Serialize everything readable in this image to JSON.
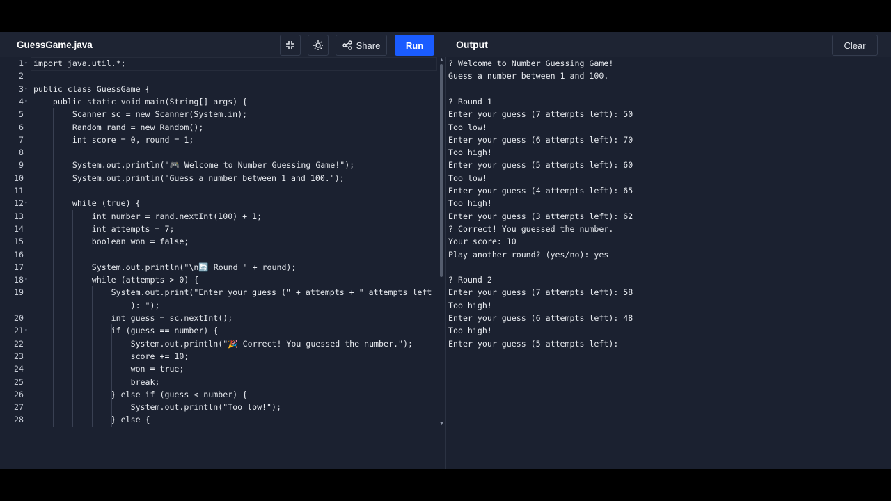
{
  "topbar": {
    "file_tab": "GuessGame.java",
    "share_label": "Share",
    "run_label": "Run",
    "output_title": "Output",
    "clear_label": "Clear"
  },
  "editor": {
    "lines": [
      {
        "n": "1",
        "t": "import java.util.*;"
      },
      {
        "n": "2",
        "t": ""
      },
      {
        "n": "3",
        "t": "public class GuessGame {"
      },
      {
        "n": "4",
        "t": "    public static void main(String[] args) {"
      },
      {
        "n": "5",
        "t": "        Scanner sc = new Scanner(System.in);"
      },
      {
        "n": "6",
        "t": "        Random rand = new Random();"
      },
      {
        "n": "7",
        "t": "        int score = 0, round = 1;"
      },
      {
        "n": "8",
        "t": ""
      },
      {
        "n": "9",
        "t": "        System.out.println(\"🎮 Welcome to Number Guessing Game!\");"
      },
      {
        "n": "10",
        "t": "        System.out.println(\"Guess a number between 1 and 100.\");"
      },
      {
        "n": "11",
        "t": ""
      },
      {
        "n": "12",
        "t": "        while (true) {"
      },
      {
        "n": "13",
        "t": "            int number = rand.nextInt(100) + 1;"
      },
      {
        "n": "14",
        "t": "            int attempts = 7;"
      },
      {
        "n": "15",
        "t": "            boolean won = false;"
      },
      {
        "n": "16",
        "t": ""
      },
      {
        "n": "17",
        "t": "            System.out.println(\"\\n🔄 Round \" + round);"
      },
      {
        "n": "18",
        "t": "            while (attempts > 0) {"
      },
      {
        "n": "19",
        "t": "                System.out.print(\"Enter your guess (\" + attempts + \" attempts left"
      },
      {
        "n": "",
        "t": "                    ): \");"
      },
      {
        "n": "20",
        "t": "                int guess = sc.nextInt();"
      },
      {
        "n": "21",
        "t": "                if (guess == number) {"
      },
      {
        "n": "22",
        "t": "                    System.out.println(\"🎉 Correct! You guessed the number.\");"
      },
      {
        "n": "23",
        "t": "                    score += 10;"
      },
      {
        "n": "24",
        "t": "                    won = true;"
      },
      {
        "n": "25",
        "t": "                    break;"
      },
      {
        "n": "26",
        "t": "                } else if (guess < number) {"
      },
      {
        "n": "27",
        "t": "                    System.out.println(\"Too low!\");"
      },
      {
        "n": "28",
        "t": "                } else {"
      }
    ]
  },
  "output": {
    "lines": [
      "? Welcome to Number Guessing Game!",
      "Guess a number between 1 and 100.",
      "",
      "? Round 1",
      "Enter your guess (7 attempts left): 50",
      "Too low!",
      "Enter your guess (6 attempts left): 70",
      "Too high!",
      "Enter your guess (5 attempts left): 60",
      "Too low!",
      "Enter your guess (4 attempts left): 65",
      "Too high!",
      "Enter your guess (3 attempts left): 62",
      "? Correct! You guessed the number.",
      "Your score: 10",
      "Play another round? (yes/no): yes",
      "",
      "? Round 2",
      "Enter your guess (7 attempts left): 58",
      "Too high!",
      "Enter your guess (6 attempts left): 48",
      "Too high!",
      "Enter your guess (5 attempts left):"
    ]
  },
  "colors": {
    "accent": "#1a5cff",
    "background": "#1b2130"
  }
}
